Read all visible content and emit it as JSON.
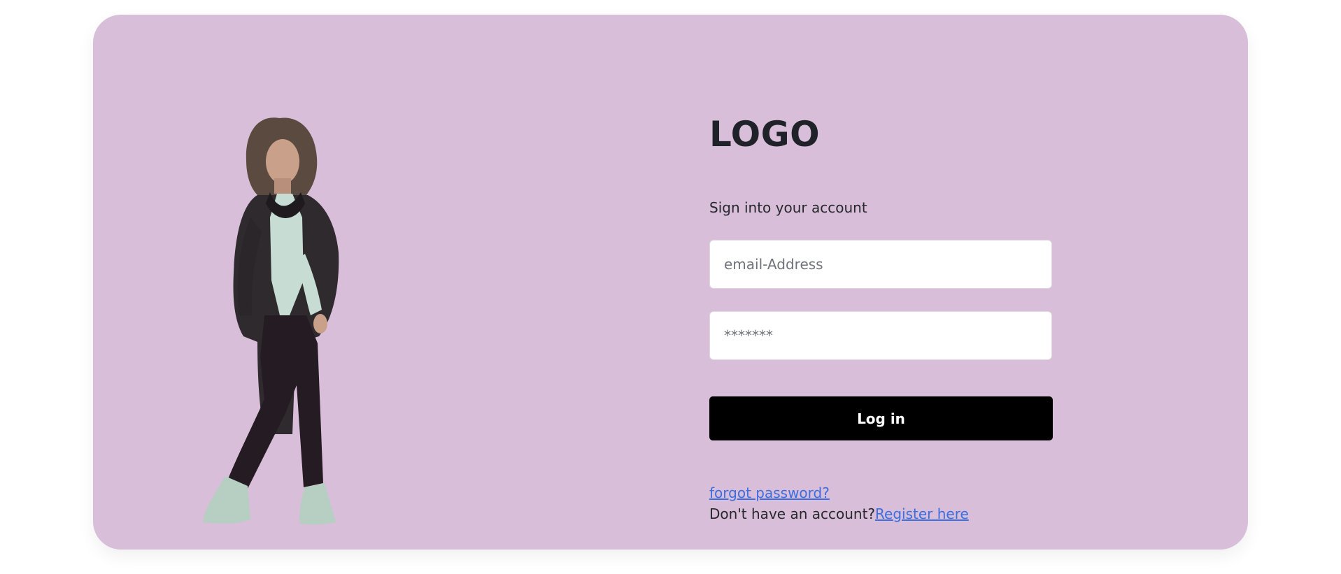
{
  "brand": {
    "logo_text": "LOGO",
    "card_color": "#d8bed8",
    "button_color": "#000000",
    "link_color": "#3b6ee0"
  },
  "login": {
    "subtitle": "Sign into your account",
    "email_placeholder": "email-Address",
    "password_placeholder": "*******",
    "submit_label": "Log in",
    "forgot_label": "forgot password?",
    "no_account_text": "Don't have an account?",
    "register_label": "Register here"
  },
  "hero": {
    "image": "woman-fashion-model-illustration"
  }
}
